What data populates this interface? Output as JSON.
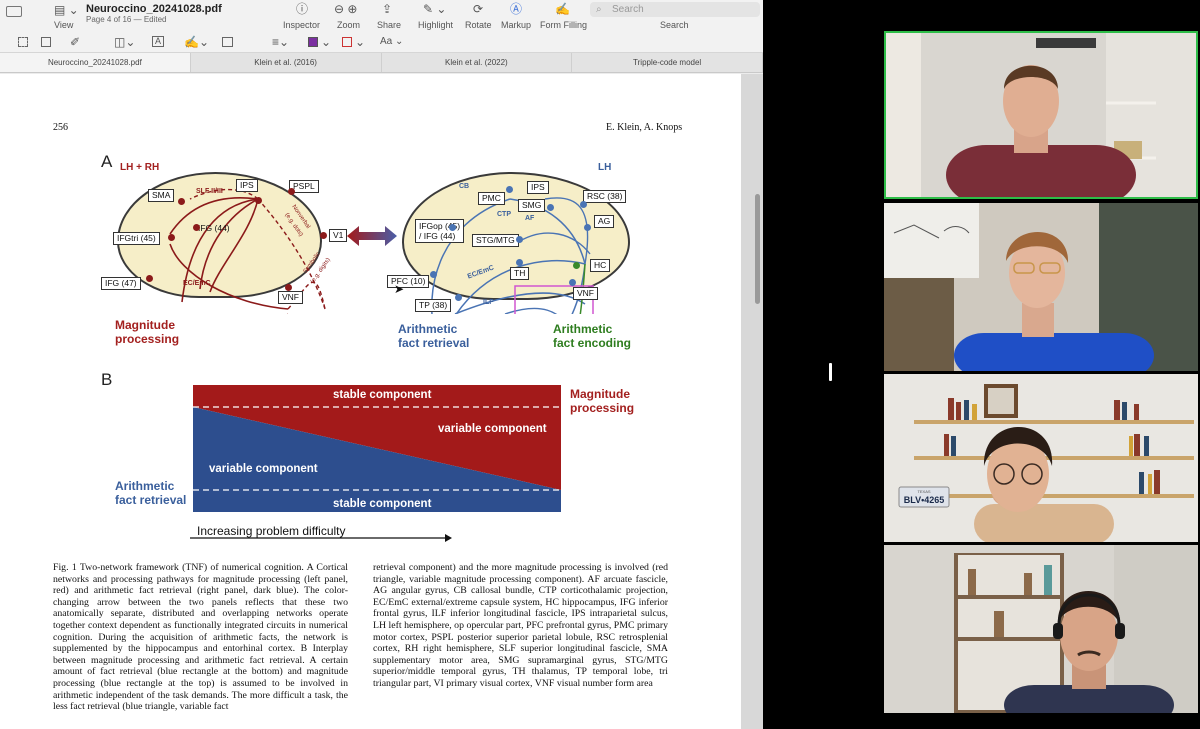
{
  "window": {
    "doc_title": "Neuroccino_20241028.pdf",
    "doc_subtitle": "Page 4 of 16 — Edited",
    "view_label": "View",
    "toolbar_items": [
      {
        "label": "Inspector",
        "icon": "info-icon"
      },
      {
        "label": "Zoom",
        "icon": "zoom-icon"
      },
      {
        "label": "Share",
        "icon": "share-icon"
      },
      {
        "label": "Highlight",
        "icon": "pen-icon"
      },
      {
        "label": "Rotate",
        "icon": "rotate-icon"
      },
      {
        "label": "Markup",
        "icon": "markup-icon"
      },
      {
        "label": "Form Filling",
        "icon": "form-icon"
      }
    ],
    "search_placeholder": "Search",
    "search_label": "Search",
    "tabs": [
      "Neuroccino_20241028.pdf",
      "Klein et al. (2016)",
      "Klein et al. (2022)",
      "Tripple-code model"
    ],
    "font_button": "Aa"
  },
  "page": {
    "number": "256",
    "authors": "E. Klein, A. Knops"
  },
  "figA": {
    "letter": "A",
    "left_hemi": "LH + RH",
    "right_hemi": "LH",
    "left_labels": {
      "sma": "SMA",
      "ips": "IPS",
      "pspl": "PSPL",
      "ifgtri": "IFGtri (45)",
      "ifg44": "IFG (44)",
      "ifg47": "IFG (47)",
      "v1": "V1",
      "vnf": "VNF"
    },
    "left_paths": {
      "slf": "SLF II/III",
      "ecemc": "EC/EmC",
      "nonverbal": "Nonverbal",
      "nonverbal2": "(e.g. dots)",
      "symbolic": "Symbolic",
      "symbolic2": "(e.g. digits)"
    },
    "right_labels": {
      "ips": "IPS",
      "rsc": "RSC (38)",
      "pmc": "PMC",
      "smg": "SMG",
      "ag": "AG",
      "ifgop": "IFGop (45)",
      "ifgop2": "/ IFG (44)",
      "stgmtg": "STG/MTG",
      "hc": "HC",
      "th": "TH",
      "pfc": "PFC (10)",
      "tp": "TP (38)",
      "vnf": "VNF"
    },
    "right_paths": {
      "cb": "CB",
      "ctp": "CTP",
      "af": "AF",
      "ecemc": "EC/EmC",
      "ilf": "ILF"
    },
    "heading_mag": [
      "Magnitude",
      "processing"
    ],
    "heading_afr": [
      "Arithmetic",
      "fact retrieval"
    ],
    "heading_afe": [
      "Arithmetic",
      "fact encoding"
    ]
  },
  "figB": {
    "letter": "B",
    "stable_top": "stable component",
    "variable_red": "variable component",
    "variable_blue": "variable component",
    "stable_bottom": "stable component",
    "right_label": [
      "Magnitude",
      "processing"
    ],
    "left_label": [
      "Arithmetic",
      "fact retrieval"
    ],
    "axis_label": "Increasing problem difficulty",
    "colors": {
      "red": "#a31a1a",
      "blue": "#2d4e8e"
    }
  },
  "caption": {
    "col1": "Fig. 1 Two-network framework (TNF) of numerical cognition. A Cortical networks and processing pathways for magnitude processing (left panel, red) and arithmetic fact retrieval (right panel, dark blue). The color-changing arrow between the two panels reflects that these two anatomically separate, distributed and overlapping networks operate together context dependent as functionally integrated circuits in numerical cognition. During the acquisition of arithmetic facts, the network is supplemented by the hippocampus and entorhinal cortex. B Interplay between magnitude processing and arithmetic fact retrieval. A certain amount of fact retrieval (blue rectangle at the bottom) and magnitude processing (blue rectangle at the top) is assumed to be involved in arithmetic independent of the task demands. The more difficult a task, the less fact retrieval (blue triangle, variable fact",
    "col2": "retrieval component) and the more magnitude processing is involved (red triangle, variable magnitude processing component). AF arcuate fascicle, AG angular gyrus, CB callosal bundle, CTP corticothalamic projection, EC/EmC external/extreme capsule system, HC hippocampus, IFG inferior frontal gyrus, ILF inferior longitudinal fascicle, IPS intraparietal sulcus, LH left hemisphere, op opercular part, PFC prefrontal gyrus, PMC primary motor cortex, PSPL posterior superior parietal lobule, RSC retrosplenial cortex, RH right hemisphere, SLF superior longitudinal fascicle, SMA supplementary motor area, SMG supramarginal gyrus, STG/MTG superior/middle temporal gyrus, TH thalamus, TP temporal lobe, tri triangular part, VI primary visual cortex, VNF visual number form area"
  },
  "video": {
    "participants": [
      {
        "name": "participant-1",
        "active": true
      },
      {
        "name": "participant-2",
        "active": false
      },
      {
        "name": "participant-3",
        "active": false
      },
      {
        "name": "participant-4",
        "active": false
      }
    ],
    "active_color": "#2ebd48",
    "plate_text": "BLV•4265",
    "plate_state": "TEXAS"
  }
}
